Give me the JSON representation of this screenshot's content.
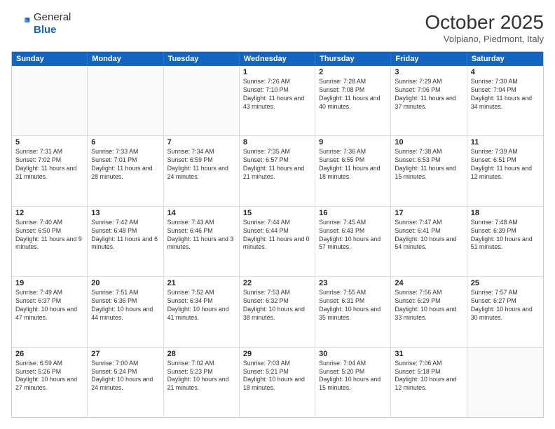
{
  "logo": {
    "general": "General",
    "blue": "Blue"
  },
  "title": "October 2025",
  "subtitle": "Volpiano, Piedmont, Italy",
  "days_of_week": [
    "Sunday",
    "Monday",
    "Tuesday",
    "Wednesday",
    "Thursday",
    "Friday",
    "Saturday"
  ],
  "rows": [
    [
      {
        "day": "",
        "detail": ""
      },
      {
        "day": "",
        "detail": ""
      },
      {
        "day": "",
        "detail": ""
      },
      {
        "day": "1",
        "detail": "Sunrise: 7:26 AM\nSunset: 7:10 PM\nDaylight: 11 hours and 43 minutes."
      },
      {
        "day": "2",
        "detail": "Sunrise: 7:28 AM\nSunset: 7:08 PM\nDaylight: 11 hours and 40 minutes."
      },
      {
        "day": "3",
        "detail": "Sunrise: 7:29 AM\nSunset: 7:06 PM\nDaylight: 11 hours and 37 minutes."
      },
      {
        "day": "4",
        "detail": "Sunrise: 7:30 AM\nSunset: 7:04 PM\nDaylight: 11 hours and 34 minutes."
      }
    ],
    [
      {
        "day": "5",
        "detail": "Sunrise: 7:31 AM\nSunset: 7:02 PM\nDaylight: 11 hours and 31 minutes."
      },
      {
        "day": "6",
        "detail": "Sunrise: 7:33 AM\nSunset: 7:01 PM\nDaylight: 11 hours and 28 minutes."
      },
      {
        "day": "7",
        "detail": "Sunrise: 7:34 AM\nSunset: 6:59 PM\nDaylight: 11 hours and 24 minutes."
      },
      {
        "day": "8",
        "detail": "Sunrise: 7:35 AM\nSunset: 6:57 PM\nDaylight: 11 hours and 21 minutes."
      },
      {
        "day": "9",
        "detail": "Sunrise: 7:36 AM\nSunset: 6:55 PM\nDaylight: 11 hours and 18 minutes."
      },
      {
        "day": "10",
        "detail": "Sunrise: 7:38 AM\nSunset: 6:53 PM\nDaylight: 11 hours and 15 minutes."
      },
      {
        "day": "11",
        "detail": "Sunrise: 7:39 AM\nSunset: 6:51 PM\nDaylight: 11 hours and 12 minutes."
      }
    ],
    [
      {
        "day": "12",
        "detail": "Sunrise: 7:40 AM\nSunset: 6:50 PM\nDaylight: 11 hours and 9 minutes."
      },
      {
        "day": "13",
        "detail": "Sunrise: 7:42 AM\nSunset: 6:48 PM\nDaylight: 11 hours and 6 minutes."
      },
      {
        "day": "14",
        "detail": "Sunrise: 7:43 AM\nSunset: 6:46 PM\nDaylight: 11 hours and 3 minutes."
      },
      {
        "day": "15",
        "detail": "Sunrise: 7:44 AM\nSunset: 6:44 PM\nDaylight: 11 hours and 0 minutes."
      },
      {
        "day": "16",
        "detail": "Sunrise: 7:45 AM\nSunset: 6:43 PM\nDaylight: 10 hours and 57 minutes."
      },
      {
        "day": "17",
        "detail": "Sunrise: 7:47 AM\nSunset: 6:41 PM\nDaylight: 10 hours and 54 minutes."
      },
      {
        "day": "18",
        "detail": "Sunrise: 7:48 AM\nSunset: 6:39 PM\nDaylight: 10 hours and 51 minutes."
      }
    ],
    [
      {
        "day": "19",
        "detail": "Sunrise: 7:49 AM\nSunset: 6:37 PM\nDaylight: 10 hours and 47 minutes."
      },
      {
        "day": "20",
        "detail": "Sunrise: 7:51 AM\nSunset: 6:36 PM\nDaylight: 10 hours and 44 minutes."
      },
      {
        "day": "21",
        "detail": "Sunrise: 7:52 AM\nSunset: 6:34 PM\nDaylight: 10 hours and 41 minutes."
      },
      {
        "day": "22",
        "detail": "Sunrise: 7:53 AM\nSunset: 6:32 PM\nDaylight: 10 hours and 38 minutes."
      },
      {
        "day": "23",
        "detail": "Sunrise: 7:55 AM\nSunset: 6:31 PM\nDaylight: 10 hours and 35 minutes."
      },
      {
        "day": "24",
        "detail": "Sunrise: 7:56 AM\nSunset: 6:29 PM\nDaylight: 10 hours and 33 minutes."
      },
      {
        "day": "25",
        "detail": "Sunrise: 7:57 AM\nSunset: 6:27 PM\nDaylight: 10 hours and 30 minutes."
      }
    ],
    [
      {
        "day": "26",
        "detail": "Sunrise: 6:59 AM\nSunset: 5:26 PM\nDaylight: 10 hours and 27 minutes."
      },
      {
        "day": "27",
        "detail": "Sunrise: 7:00 AM\nSunset: 5:24 PM\nDaylight: 10 hours and 24 minutes."
      },
      {
        "day": "28",
        "detail": "Sunrise: 7:02 AM\nSunset: 5:23 PM\nDaylight: 10 hours and 21 minutes."
      },
      {
        "day": "29",
        "detail": "Sunrise: 7:03 AM\nSunset: 5:21 PM\nDaylight: 10 hours and 18 minutes."
      },
      {
        "day": "30",
        "detail": "Sunrise: 7:04 AM\nSunset: 5:20 PM\nDaylight: 10 hours and 15 minutes."
      },
      {
        "day": "31",
        "detail": "Sunrise: 7:06 AM\nSunset: 5:18 PM\nDaylight: 10 hours and 12 minutes."
      },
      {
        "day": "",
        "detail": ""
      }
    ]
  ]
}
